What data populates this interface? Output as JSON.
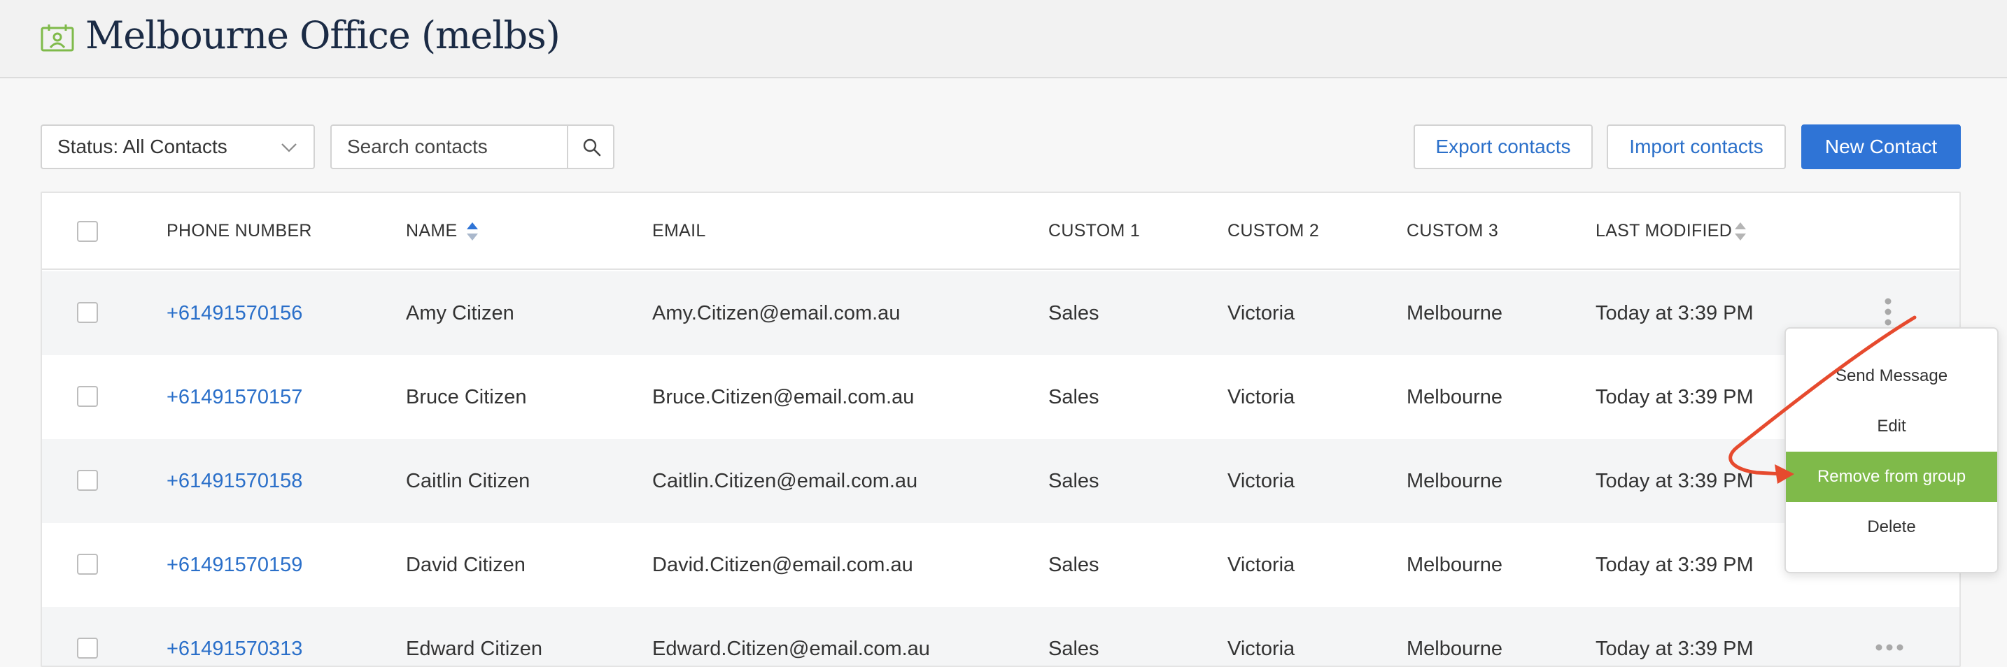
{
  "header": {
    "title": "Melbourne Office (melbs)",
    "icon": "address-book-icon",
    "icon_color": "#7fba4a"
  },
  "toolbar": {
    "status_select_value": "Status: All Contacts",
    "search_placeholder": "Search contacts",
    "export_label": "Export contacts",
    "import_label": "Import contacts",
    "new_label": "New Contact"
  },
  "table": {
    "headers": {
      "phone": "PHONE NUMBER",
      "name": "NAME",
      "email": "EMAIL",
      "custom1": "CUSTOM 1",
      "custom2": "CUSTOM 2",
      "custom3": "CUSTOM 3",
      "last_modified": "LAST MODIFIED"
    },
    "rows": [
      {
        "phone": "+61491570156",
        "name": "Amy Citizen",
        "email": "Amy.Citizen@email.com.au",
        "custom1": "Sales",
        "custom2": "Victoria",
        "custom3": "Melbourne",
        "modified": "Today at 3:39 PM"
      },
      {
        "phone": "+61491570157",
        "name": "Bruce Citizen",
        "email": "Bruce.Citizen@email.com.au",
        "custom1": "Sales",
        "custom2": "Victoria",
        "custom3": "Melbourne",
        "modified": "Today at 3:39 PM"
      },
      {
        "phone": "+61491570158",
        "name": "Caitlin Citizen",
        "email": "Caitlin.Citizen@email.com.au",
        "custom1": "Sales",
        "custom2": "Victoria",
        "custom3": "Melbourne",
        "modified": "Today at 3:39 PM"
      },
      {
        "phone": "+61491570159",
        "name": "David Citizen",
        "email": "David.Citizen@email.com.au",
        "custom1": "Sales",
        "custom2": "Victoria",
        "custom3": "Melbourne",
        "modified": "Today at 3:39 PM"
      },
      {
        "phone": "+61491570313",
        "name": "Edward Citizen",
        "email": "Edward.Citizen@email.com.au",
        "custom1": "Sales",
        "custom2": "Victoria",
        "custom3": "Melbourne",
        "modified": "Today at 3:39 PM"
      }
    ]
  },
  "context_menu": {
    "items": [
      "Send Message",
      "Edit",
      "Remove from group",
      "Delete"
    ],
    "active_item": "Remove from group",
    "active_color": "#7fba4a"
  },
  "colors": {
    "link": "#2a6fc9",
    "primary": "#2f74d6",
    "annotation_arrow": "#e64a2e"
  }
}
